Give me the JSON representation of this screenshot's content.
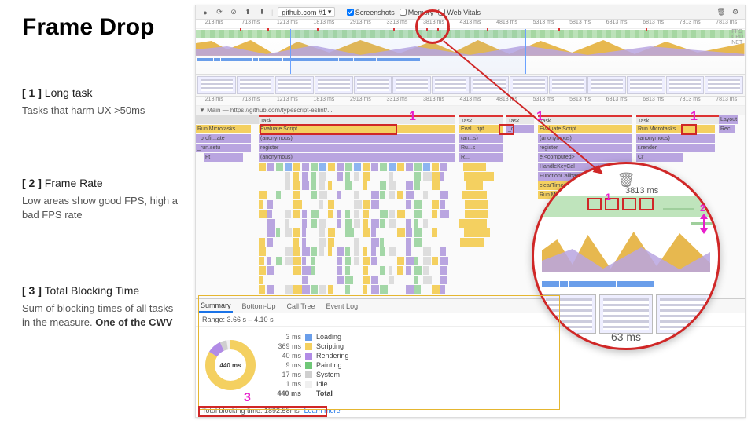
{
  "slide": {
    "title": "Frame Drop",
    "sections": [
      {
        "num": "[ 1 ]",
        "title": "Long task",
        "body": "Tasks that harm UX >50ms"
      },
      {
        "num": "[ 2 ]",
        "title": "Frame Rate",
        "body": "Low areas show good FPS, high a bad FPS rate"
      },
      {
        "num": "[ 3 ]",
        "title": "Total Blocking Time",
        "body": "Sum of blocking times of all tasks in the measure. ",
        "bold": "One of the CWV"
      }
    ]
  },
  "toolbar": {
    "target": "github.com #1",
    "checkboxes": {
      "screenshots": "Screenshots",
      "memory": "Memory",
      "webvitals": "Web Vitals"
    },
    "checked": {
      "screenshots": true,
      "memory": false,
      "webvitals": false
    }
  },
  "ruler_ticks": [
    "213 ms",
    "713 ms",
    "1213 ms",
    "1813 ms",
    "2913 ms",
    "3313 ms",
    "3813 ms",
    "4313 ms",
    "4813 ms",
    "5313 ms",
    "5813 ms",
    "6313 ms",
    "6813 ms",
    "7313 ms",
    "7813 ms"
  ],
  "overview_labels": {
    "fps": "FPS",
    "cpu": "CPU",
    "net": "NET"
  },
  "flame": {
    "main_label": "▼ Main — https://github.com/typescript-eslint/...",
    "items": {
      "task": "Task",
      "eval": "Evaluate Script",
      "run_micro": "Run Microtasks",
      "anon": "(anonymous)",
      "register": "register",
      "profile": "_profil...ate",
      "runSetu": "_run.setu",
      "ft": "Ft",
      "computed": "e.<computed>",
      "handleKey": "HandleKeyCal",
      "funcCb": "FunctionCallback",
      "clearTimeout": "clearTimeout",
      "render": "r.render",
      "recalc": "Rec...d",
      "layout": "Layout"
    }
  },
  "summary": {
    "tabs": [
      "Summary",
      "Bottom-Up",
      "Call Tree",
      "Event Log"
    ],
    "range": "Range: 3.66 s – 4.10 s",
    "center": "440 ms",
    "legend": [
      {
        "ms": "3 ms",
        "label": "Loading",
        "color": "#6a9eea"
      },
      {
        "ms": "369 ms",
        "label": "Scripting",
        "color": "#f4d060"
      },
      {
        "ms": "40 ms",
        "label": "Rendering",
        "color": "#b18be6"
      },
      {
        "ms": "9 ms",
        "label": "Painting",
        "color": "#6fc777"
      },
      {
        "ms": "17 ms",
        "label": "System",
        "color": "#cfcfcf"
      },
      {
        "ms": "1 ms",
        "label": "Idle",
        "color": "#f0f0f0"
      }
    ],
    "total_ms": "440 ms",
    "total_label": "Total",
    "tbt": "Total blocking time: 1892.58ms",
    "tbt_link": "Learn more"
  },
  "magnifier": {
    "tick": "3813 ms",
    "bottom_ms": "63 ms"
  },
  "callouts": {
    "one": "1",
    "two": "2",
    "three": "3"
  }
}
